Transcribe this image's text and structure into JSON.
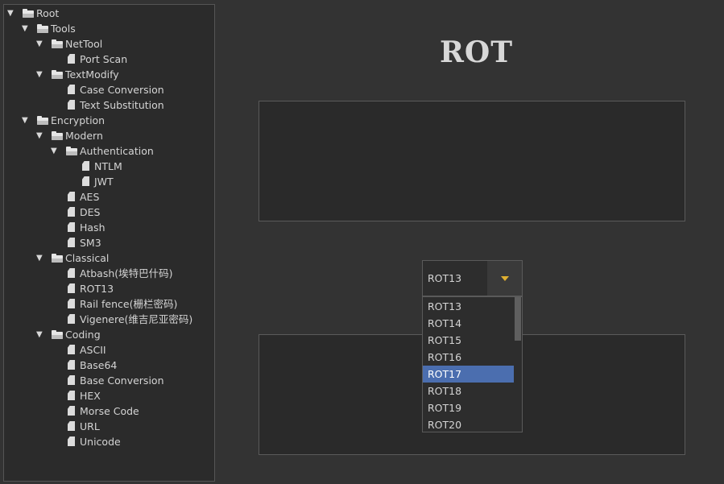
{
  "tree": [
    {
      "label": "Root",
      "level": 0,
      "type": "folder",
      "expanded": true
    },
    {
      "label": "Tools",
      "level": 1,
      "type": "folder",
      "expanded": true
    },
    {
      "label": "NetTool",
      "level": 2,
      "type": "folder",
      "expanded": true
    },
    {
      "label": "Port Scan",
      "level": 3,
      "type": "file"
    },
    {
      "label": "TextModify",
      "level": 2,
      "type": "folder",
      "expanded": true
    },
    {
      "label": "Case Conversion",
      "level": 3,
      "type": "file"
    },
    {
      "label": "Text Substitution",
      "level": 3,
      "type": "file"
    },
    {
      "label": "Encryption",
      "level": 1,
      "type": "folder",
      "expanded": true
    },
    {
      "label": "Modern",
      "level": 2,
      "type": "folder",
      "expanded": true
    },
    {
      "label": "Authentication",
      "level": 3,
      "type": "folder",
      "expanded": true
    },
    {
      "label": "NTLM",
      "level": 4,
      "type": "file"
    },
    {
      "label": "JWT",
      "level": 4,
      "type": "file"
    },
    {
      "label": "AES",
      "level": 3,
      "type": "file"
    },
    {
      "label": "DES",
      "level": 3,
      "type": "file"
    },
    {
      "label": "Hash",
      "level": 3,
      "type": "file"
    },
    {
      "label": "SM3",
      "level": 3,
      "type": "file"
    },
    {
      "label": "Classical",
      "level": 2,
      "type": "folder",
      "expanded": true
    },
    {
      "label": "Atbash(埃特巴什码)",
      "level": 3,
      "type": "file"
    },
    {
      "label": "ROT13",
      "level": 3,
      "type": "file",
      "selected": true
    },
    {
      "label": "Rail fence(栅栏密码)",
      "level": 3,
      "type": "file"
    },
    {
      "label": "Vigenere(维吉尼亚密码)",
      "level": 3,
      "type": "file"
    },
    {
      "label": "Coding",
      "level": 2,
      "type": "folder",
      "expanded": true
    },
    {
      "label": "ASCII",
      "level": 3,
      "type": "file"
    },
    {
      "label": "Base64",
      "level": 3,
      "type": "file"
    },
    {
      "label": "Base Conversion",
      "level": 3,
      "type": "file"
    },
    {
      "label": "HEX",
      "level": 3,
      "type": "file"
    },
    {
      "label": "Morse Code",
      "level": 3,
      "type": "file"
    },
    {
      "label": "URL",
      "level": 3,
      "type": "file"
    },
    {
      "label": "Unicode",
      "level": 3,
      "type": "file"
    }
  ],
  "main": {
    "title": "ROT",
    "input_text": "",
    "output_text": "",
    "combo": {
      "value": "ROT13",
      "options": [
        "ROT13",
        "ROT14",
        "ROT15",
        "ROT16",
        "ROT17",
        "ROT18",
        "ROT19",
        "ROT20"
      ],
      "highlighted": "ROT17"
    }
  },
  "colors": {
    "background": "#333333",
    "panel": "#2b2b2b",
    "selection": "#4b6eaf",
    "arrow_accent": "#e0b030"
  }
}
